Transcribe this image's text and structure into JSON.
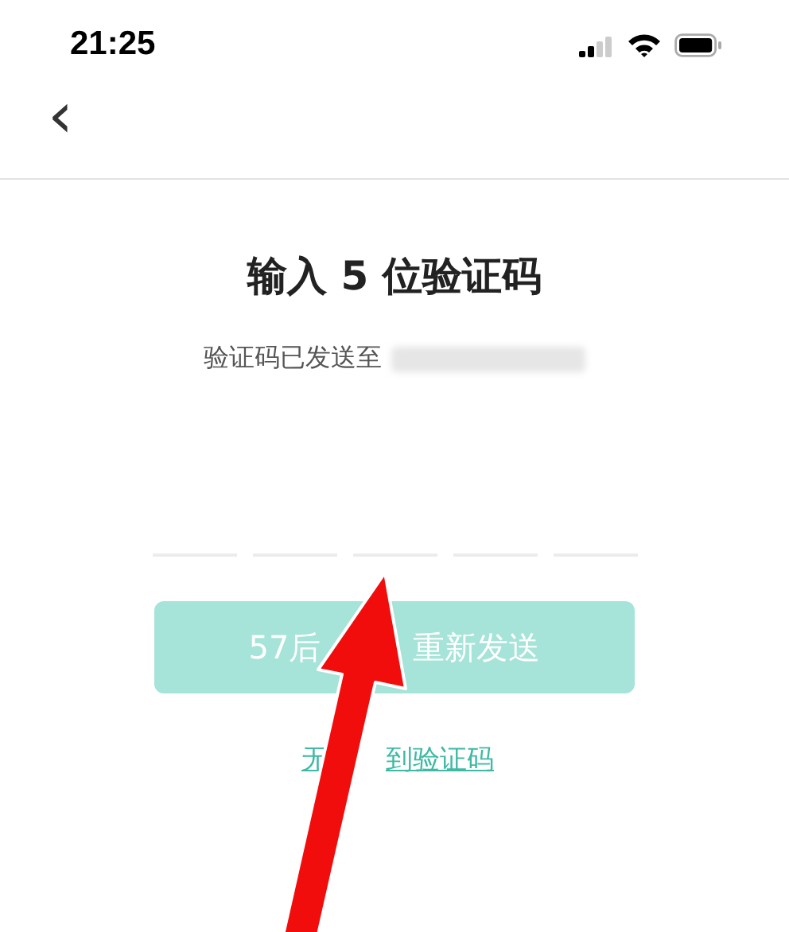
{
  "status_bar": {
    "time": "21:25",
    "signal_bars": [
      {
        "on": true
      },
      {
        "on": true
      },
      {
        "on": false
      },
      {
        "on": false
      }
    ]
  },
  "nav": {
    "back": "‹"
  },
  "title": "输入 5 位验证码",
  "subtitle": {
    "text": "验证码已发送至",
    "recipient_hidden": true
  },
  "slots": [
    {
      "filled": false
    },
    {
      "filled": false
    },
    {
      "filled": false
    },
    {
      "filled": false
    },
    {
      "filled": false
    }
  ],
  "resend_button": {
    "disabled": true,
    "label_parts": [
      "57后",
      "重新发送"
    ]
  },
  "help_link_parts": [
    "无",
    "到验证码"
  ],
  "annotation": {
    "kind": "arrow"
  }
}
